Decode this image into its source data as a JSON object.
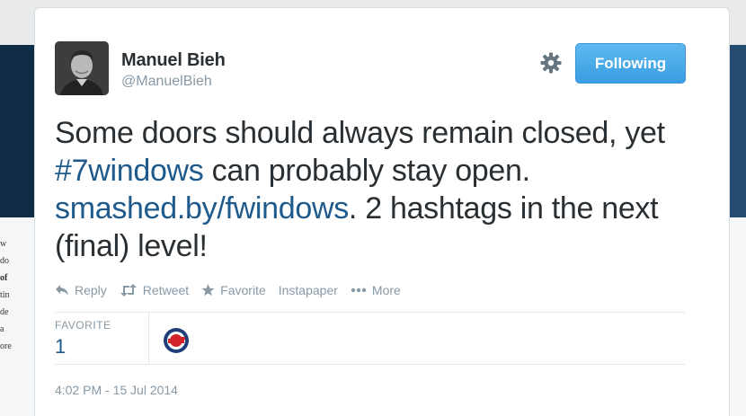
{
  "background": {
    "fragments": [
      "w",
      "do",
      "of",
      "tin",
      "de",
      "a",
      "ore"
    ]
  },
  "tweet": {
    "display_name": "Manuel Bieh",
    "screen_name": "@ManuelBieh",
    "follow_label": "Following",
    "text": {
      "part1": "Some doors should always remain closed, yet ",
      "hashtag": "#7windows",
      "part2": " can probably stay open. ",
      "link": "smashed.by/fwindows",
      "part3": ". 2 hashtags in the next (final) level!"
    },
    "actions": {
      "reply": "Reply",
      "retweet": "Retweet",
      "favorite": "Favorite",
      "instapaper": "Instapaper",
      "more": "More"
    },
    "stats": {
      "favorite_label": "FAVORITE",
      "favorite_count": "1"
    },
    "timestamp": "4:02 PM - 15 Jul 2014"
  },
  "colors": {
    "link": "#1f5a8c",
    "follow_button": "#3a9ee2",
    "muted": "#8899a6"
  },
  "icons": [
    "avatar",
    "gear-icon",
    "reply-icon",
    "retweet-icon",
    "star-icon",
    "more-dots-icon",
    "favoriter-avatar"
  ]
}
